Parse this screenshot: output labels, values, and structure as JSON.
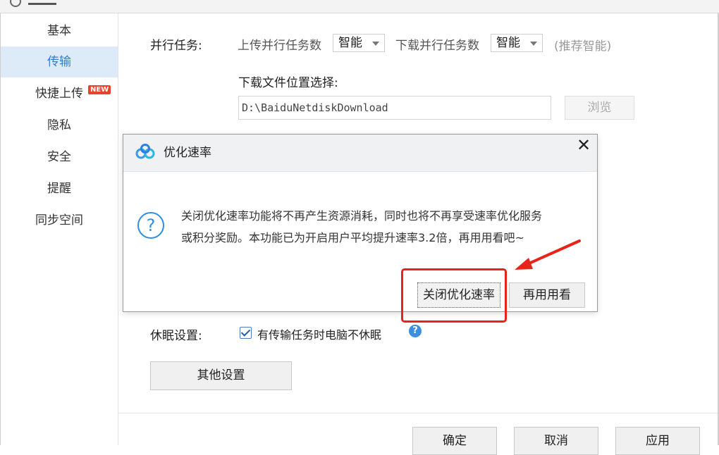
{
  "sidebar": {
    "items": [
      {
        "label": "基本"
      },
      {
        "label": "传输"
      },
      {
        "label": "快捷上传",
        "badge": "NEW"
      },
      {
        "label": "隐私"
      },
      {
        "label": "安全"
      },
      {
        "label": "提醒"
      },
      {
        "label": "同步空间"
      }
    ]
  },
  "transfer": {
    "parallel_label": "并行任务:",
    "upload_label": "上传并行任务数",
    "upload_value": "智能",
    "download_label": "下载并行任务数",
    "download_value": "智能",
    "recommend_hint": "(推荐智能)",
    "location_label": "下载文件位置选择:",
    "path_value": "D:\\BaiduNetdiskDownload",
    "browse_label": "浏览",
    "sleep_label": "休眠设置:",
    "sleep_checkbox_label": "有传输任务时电脑不休眠",
    "sleep_checked": true,
    "other_settings_label": "其他设置"
  },
  "dialog": {
    "title": "优化速率",
    "message_line1": "关闭优化速率功能将不再产生资源消耗，同时也将不再享受速率优化服务",
    "message_line2": "或积分奖励。本功能已为开启用户平均提升速率3.2倍，再用用看吧~",
    "close_speed_label": "关闭优化速率",
    "try_again_label": "再用用看",
    "help_glyph": "?",
    "close_glyph": "✕"
  },
  "footer": {
    "ok_label": "确定",
    "cancel_label": "取消",
    "apply_label": "应用"
  },
  "colors": {
    "accent": "#2a7fd4",
    "active_bg": "#dcebf7",
    "annotation_red": "#e8231c",
    "badge_red": "#e8412d"
  }
}
